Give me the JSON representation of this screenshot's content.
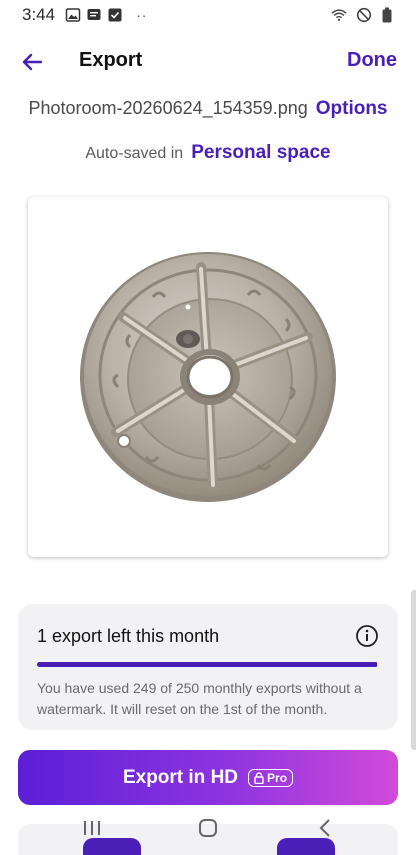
{
  "status_bar": {
    "time": "3:44",
    "icons": [
      "gallery-icon",
      "message-icon",
      "check-icon",
      "wifi-icon",
      "do-not-disturb-icon",
      "battery-icon"
    ],
    "dots": "··"
  },
  "header": {
    "title": "Export",
    "done_label": "Done"
  },
  "file": {
    "name": "Photoroom-20260624_154359.png",
    "options_label": "Options"
  },
  "saved": {
    "label": "Auto-saved in",
    "space": "Personal space"
  },
  "export_info": {
    "title": "1 export left this month",
    "description": "You have used 249 of 250 monthly exports without a watermark. It will reset on the 1st of the month.",
    "used": 249,
    "limit": 250
  },
  "export_button": {
    "label": "Export in HD",
    "badge": "Pro"
  },
  "nav": {
    "items": [
      "recents-icon",
      "home-icon",
      "back-icon"
    ]
  },
  "colors": {
    "accent": "#4a1fb8",
    "gradient_start": "#5b1fd6",
    "gradient_end": "#d24ad9",
    "card_bg": "#f2f2f4"
  }
}
